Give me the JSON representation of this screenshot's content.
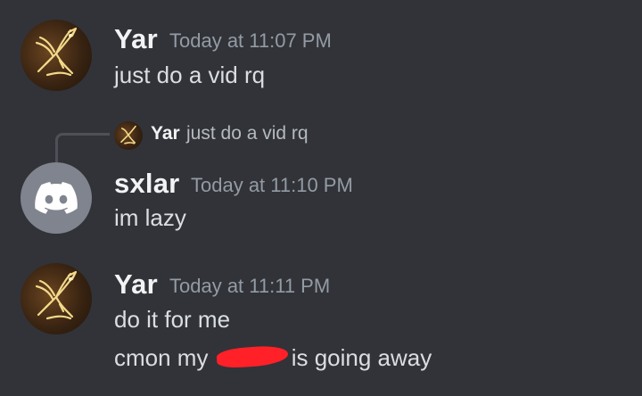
{
  "messages": [
    {
      "username": "Yar",
      "timestamp": "Today at 11:07 PM",
      "lines": [
        "just do a vid rq"
      ]
    },
    {
      "reply": {
        "username": "Yar",
        "text": "just do a vid rq"
      },
      "username": "sxlar",
      "timestamp": "Today at 11:10 PM",
      "lines": [
        "im lazy"
      ]
    },
    {
      "username": "Yar",
      "timestamp": "Today at 11:11 PM",
      "lines": [
        "do it for me"
      ],
      "redacted_line": {
        "before": "cmon my",
        "after": "is going away"
      }
    }
  ],
  "colors": {
    "background": "#313338",
    "username": "#f2f3f5",
    "timestamp": "#949ba4",
    "text": "#dbdee1",
    "discord_avatar": "#80848e",
    "redaction": "#ff2028"
  }
}
